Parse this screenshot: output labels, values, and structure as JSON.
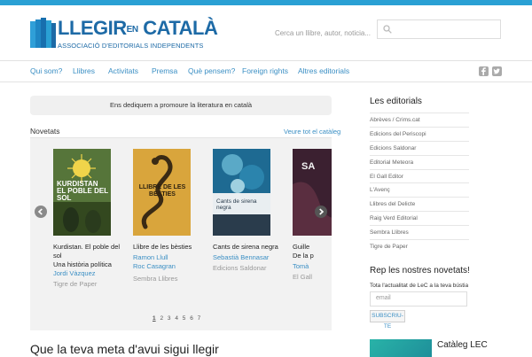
{
  "brand": {
    "title_main": "LLEGIR",
    "title_en": "EN",
    "title_end": "CATALÀ",
    "subtitle": "ASSOCIACIÓ D'EDITORIALS INDEPENDENTS",
    "color": "#1d6aa6"
  },
  "search": {
    "placeholder": "Cerca un llibre, autor, noticia..."
  },
  "nav": {
    "items": [
      "Qui som?",
      "Llibres",
      "Activitats",
      "Premsa",
      "Què pensem?",
      "Foreign rights",
      "Altres editorials"
    ]
  },
  "social": {
    "icons": [
      "facebook-icon",
      "twitter-icon"
    ]
  },
  "mission": "Ens dediquem a promoure la literatura en català",
  "novetats": {
    "heading": "Novetats",
    "see_all": "Veure tot el catàleg",
    "books": [
      {
        "title": "Kurdistan. El poble del sol\nUna història política",
        "author": "Jordi Vàzquez",
        "publisher": "Tigre de Paper",
        "cover_text": "KURDISTAN EL POBLE DEL SOL"
      },
      {
        "title": "Llibre de les bèsties",
        "author": "Ramon Llull\nRoc Casagran",
        "publisher": "Sembra Llibres",
        "cover_text": "LLIBRE DE LES BÈSTIES"
      },
      {
        "title": "Cants de sirena negra",
        "author": "Sebastià Bennasar",
        "publisher": "Edicions Saldonar",
        "cover_text": "Cants de sirena negra"
      },
      {
        "title": "Guille\nDe la p",
        "author": "Tomà",
        "publisher": "El Gall",
        "cover_text": "SA"
      }
    ],
    "pages": [
      "1",
      "2",
      "3",
      "4",
      "5",
      "6",
      "7"
    ],
    "current_page": "1"
  },
  "bottom_heading": "Que la teva meta d'avui sigui llegir",
  "sidebar": {
    "editorials_heading": "Les editorials",
    "editorials": [
      "Abrèves / Crims.cat",
      "Edicions del Periscopi",
      "Edicions Saldonar",
      "Editorial Meteora",
      "El Gall Editor",
      "L'Avenç",
      "Llibres del Delicte",
      "Raig Verd Editorial",
      "Sembra Llibres",
      "Tigre de Paper"
    ],
    "newsletter_heading": "Rep les nostres novetats!",
    "newsletter_text": "Tota l'actualitat de LeC a la teva bústia",
    "email_placeholder": "email",
    "subscribe_label": "SUBSCRIU-TE",
    "catalog_title": "Catàleg LEC"
  },
  "colors": {
    "topbar": "#2aa0d4",
    "link": "#3b8fc4"
  }
}
